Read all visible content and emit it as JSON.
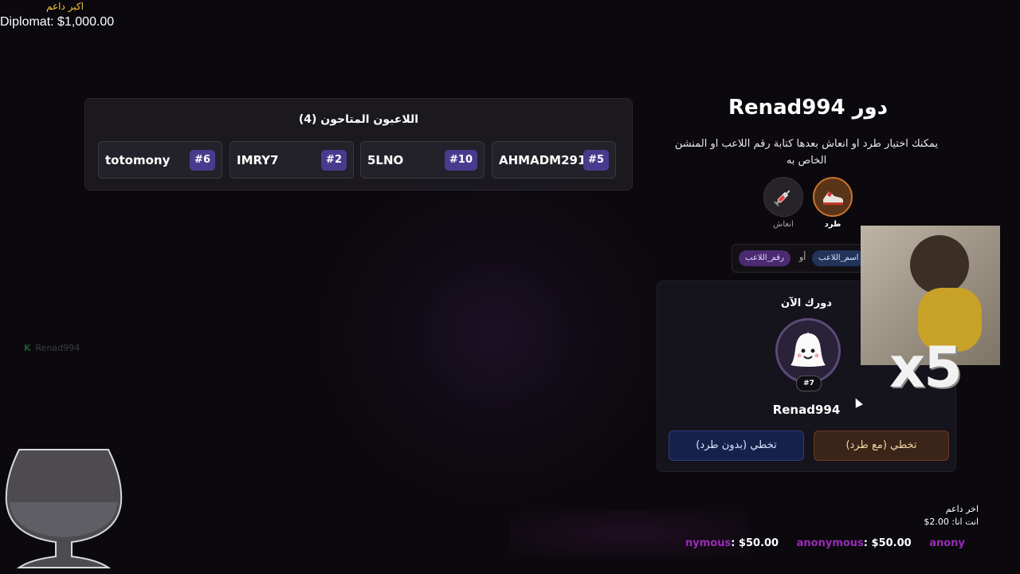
{
  "top_donor": {
    "label": "اكبر داعم",
    "line": "Diplomat: $1,000.00"
  },
  "players_panel": {
    "title": "اللاعبون المتاحون (4)",
    "players": [
      {
        "name": "totomony",
        "number": "#6"
      },
      {
        "name": "IMRY7",
        "number": "#2"
      },
      {
        "name": "5LNO",
        "number": "#10"
      },
      {
        "name": "AHMADM2910",
        "number": "#5"
      }
    ]
  },
  "turn": {
    "title": "دور Renad994",
    "instructions": "يمكنك اختيار طرد او انعاش بعدها كتابة رقم اللاعب او المنشن الخاص به"
  },
  "actions": {
    "kick_label": "طرد",
    "revive_label": "انعاش"
  },
  "hint": {
    "number_pill": "رقم_اللاعب",
    "or_word": "أو",
    "name_pill": "اسم_اللاعب"
  },
  "current": {
    "title": "دورك الآن",
    "player_number": "#7",
    "player_name": "Renad994",
    "skip_with_kick": "تخطي (مع طرد)",
    "skip_without_kick": "تخطي (بدون طرد)"
  },
  "overlay": {
    "multiplier": "x5"
  },
  "chat": {
    "user": "Renad994"
  },
  "last_donor": {
    "label": "اخر داعم",
    "line": "انت انا: 2.00$"
  },
  "ticker": [
    {
      "name": "nymous",
      "amount": ": $50.00"
    },
    {
      "name": "anonymous",
      "amount": ": $50.00"
    },
    {
      "name": "anony",
      "amount": ""
    }
  ]
}
